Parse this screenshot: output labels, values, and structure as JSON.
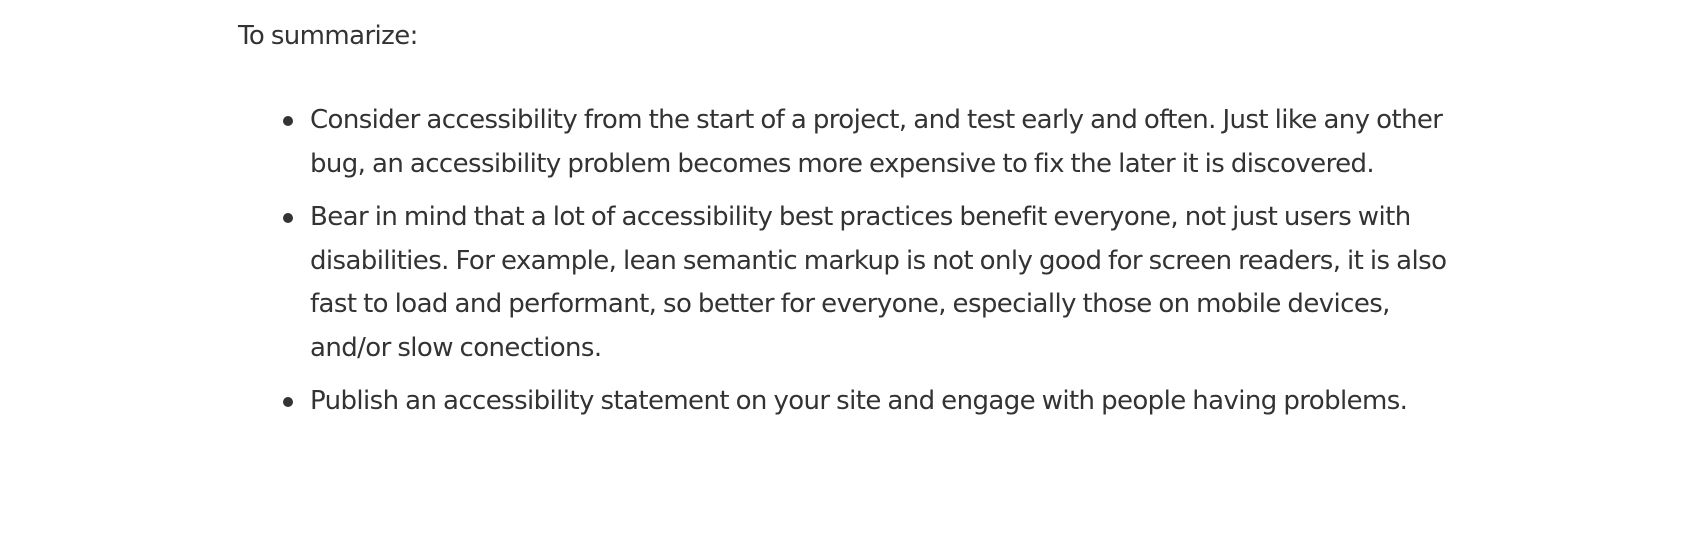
{
  "intro": "To summarize:",
  "items": [
    "Consider accessibility from the start of a project, and test early and often. Just like any other bug, an accessibility problem becomes more expensive to fix the later it is discovered.",
    "Bear in mind that a lot of accessibility best practices benefit everyone, not just users with disabilities. For example, lean semantic markup is not only good for screen readers, it is also fast to load and performant, so better for everyone, especially those on mobile devices, and/or slow conections.",
    "Publish an accessibility statement on your site and engage with people having problems."
  ]
}
